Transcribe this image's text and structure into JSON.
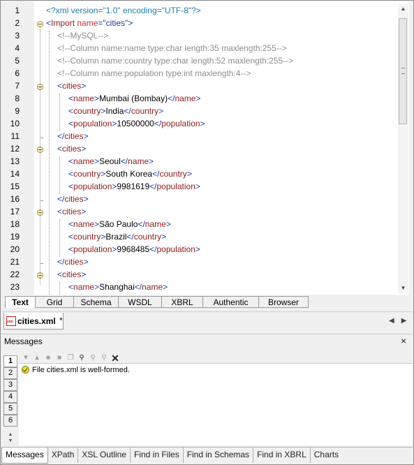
{
  "editor": {
    "lines": [
      {
        "n": "1",
        "parts": [
          [
            "pi",
            "<?xml version=\"1.0\" encoding=\"UTF-8\"?>"
          ]
        ]
      },
      {
        "n": "2",
        "parts": [
          [
            "br",
            "<"
          ],
          [
            "tag",
            "Import"
          ],
          [
            "attr",
            " name"
          ],
          [
            "br",
            "="
          ],
          [
            "val",
            "\"cities\""
          ],
          [
            "br",
            ">"
          ]
        ]
      },
      {
        "n": "3",
        "parts": [
          [
            "cm",
            "<!--MySQL-->"
          ]
        ]
      },
      {
        "n": "4",
        "parts": [
          [
            "cm",
            "<!--Column name:name type:char length:35 maxlength:255-->"
          ]
        ]
      },
      {
        "n": "5",
        "parts": [
          [
            "cm",
            "<!--Column name:country type:char length:52 maxlength:255-->"
          ]
        ]
      },
      {
        "n": "6",
        "parts": [
          [
            "cm",
            "<!--Column name:population type:int maxlength:4-->"
          ]
        ]
      },
      {
        "n": "7",
        "parts": [
          [
            "br",
            "<"
          ],
          [
            "tag",
            "cities"
          ],
          [
            "br",
            ">"
          ]
        ]
      },
      {
        "n": "8",
        "parts": [
          [
            "br",
            "<"
          ],
          [
            "tag",
            "name"
          ],
          [
            "br",
            ">"
          ],
          [
            "txt",
            "Mumbai (Bombay)"
          ],
          [
            "br",
            "</"
          ],
          [
            "tag",
            "name"
          ],
          [
            "br",
            ">"
          ]
        ]
      },
      {
        "n": "9",
        "parts": [
          [
            "br",
            "<"
          ],
          [
            "tag",
            "country"
          ],
          [
            "br",
            ">"
          ],
          [
            "txt",
            "India"
          ],
          [
            "br",
            "</"
          ],
          [
            "tag",
            "country"
          ],
          [
            "br",
            ">"
          ]
        ]
      },
      {
        "n": "10",
        "parts": [
          [
            "br",
            "<"
          ],
          [
            "tag",
            "population"
          ],
          [
            "br",
            ">"
          ],
          [
            "txt",
            "10500000"
          ],
          [
            "br",
            "</"
          ],
          [
            "tag",
            "population"
          ],
          [
            "br",
            ">"
          ]
        ]
      },
      {
        "n": "11",
        "parts": [
          [
            "br",
            "</"
          ],
          [
            "tag",
            "cities"
          ],
          [
            "br",
            ">"
          ]
        ]
      },
      {
        "n": "12",
        "parts": [
          [
            "br",
            "<"
          ],
          [
            "tag",
            "cities"
          ],
          [
            "br",
            ">"
          ]
        ]
      },
      {
        "n": "13",
        "parts": [
          [
            "br",
            "<"
          ],
          [
            "tag",
            "name"
          ],
          [
            "br",
            ">"
          ],
          [
            "txt",
            "Seoul"
          ],
          [
            "br",
            "</"
          ],
          [
            "tag",
            "name"
          ],
          [
            "br",
            ">"
          ]
        ]
      },
      {
        "n": "14",
        "parts": [
          [
            "br",
            "<"
          ],
          [
            "tag",
            "country"
          ],
          [
            "br",
            ">"
          ],
          [
            "txt",
            "South Korea"
          ],
          [
            "br",
            "</"
          ],
          [
            "tag",
            "country"
          ],
          [
            "br",
            ">"
          ]
        ]
      },
      {
        "n": "15",
        "parts": [
          [
            "br",
            "<"
          ],
          [
            "tag",
            "population"
          ],
          [
            "br",
            ">"
          ],
          [
            "txt",
            "9981619"
          ],
          [
            "br",
            "</"
          ],
          [
            "tag",
            "population"
          ],
          [
            "br",
            ">"
          ]
        ]
      },
      {
        "n": "16",
        "parts": [
          [
            "br",
            "</"
          ],
          [
            "tag",
            "cities"
          ],
          [
            "br",
            ">"
          ]
        ]
      },
      {
        "n": "17",
        "parts": [
          [
            "br",
            "<"
          ],
          [
            "tag",
            "cities"
          ],
          [
            "br",
            ">"
          ]
        ]
      },
      {
        "n": "18",
        "parts": [
          [
            "br",
            "<"
          ],
          [
            "tag",
            "name"
          ],
          [
            "br",
            ">"
          ],
          [
            "txt",
            "São Paulo"
          ],
          [
            "br",
            "</"
          ],
          [
            "tag",
            "name"
          ],
          [
            "br",
            ">"
          ]
        ]
      },
      {
        "n": "19",
        "parts": [
          [
            "br",
            "<"
          ],
          [
            "tag",
            "country"
          ],
          [
            "br",
            ">"
          ],
          [
            "txt",
            "Brazil"
          ],
          [
            "br",
            "</"
          ],
          [
            "tag",
            "country"
          ],
          [
            "br",
            ">"
          ]
        ]
      },
      {
        "n": "20",
        "parts": [
          [
            "br",
            "<"
          ],
          [
            "tag",
            "population"
          ],
          [
            "br",
            ">"
          ],
          [
            "txt",
            "9968485"
          ],
          [
            "br",
            "</"
          ],
          [
            "tag",
            "population"
          ],
          [
            "br",
            ">"
          ]
        ]
      },
      {
        "n": "21",
        "parts": [
          [
            "br",
            "</"
          ],
          [
            "tag",
            "cities"
          ],
          [
            "br",
            ">"
          ]
        ]
      },
      {
        "n": "22",
        "parts": [
          [
            "br",
            "<"
          ],
          [
            "tag",
            "cities"
          ],
          [
            "br",
            ">"
          ]
        ]
      },
      {
        "n": "23",
        "parts": [
          [
            "br",
            "<"
          ],
          [
            "tag",
            "name"
          ],
          [
            "br",
            ">"
          ],
          [
            "txt",
            "Shanghai"
          ],
          [
            "br",
            "</"
          ],
          [
            "tag",
            "name"
          ],
          [
            "br",
            ">"
          ]
        ]
      }
    ]
  },
  "view_tabs": [
    "Text",
    "Grid",
    "Schema",
    "WSDL",
    "XBRL",
    "Authentic",
    "Browser"
  ],
  "active_view_tab": "Text",
  "file_tab": {
    "name": "cities.xml",
    "modified": "*"
  },
  "messages": {
    "title": "Messages",
    "close": "×",
    "side_tabs": [
      "1",
      "2",
      "3",
      "4",
      "5",
      "6"
    ],
    "text": "File cities.xml is well-formed."
  },
  "bottom_tabs": [
    "Messages",
    "XPath",
    "XSL Outline",
    "Find in Files",
    "Find in Schemas",
    "Find in XBRL",
    "Charts"
  ],
  "active_bottom_tab": "Messages",
  "colors": {
    "pi": "#1f7ea8",
    "comment": "#8c8c8c",
    "tag": "#8b1a1a",
    "bracket": "#1a3ca8",
    "attr": "#c83232"
  }
}
